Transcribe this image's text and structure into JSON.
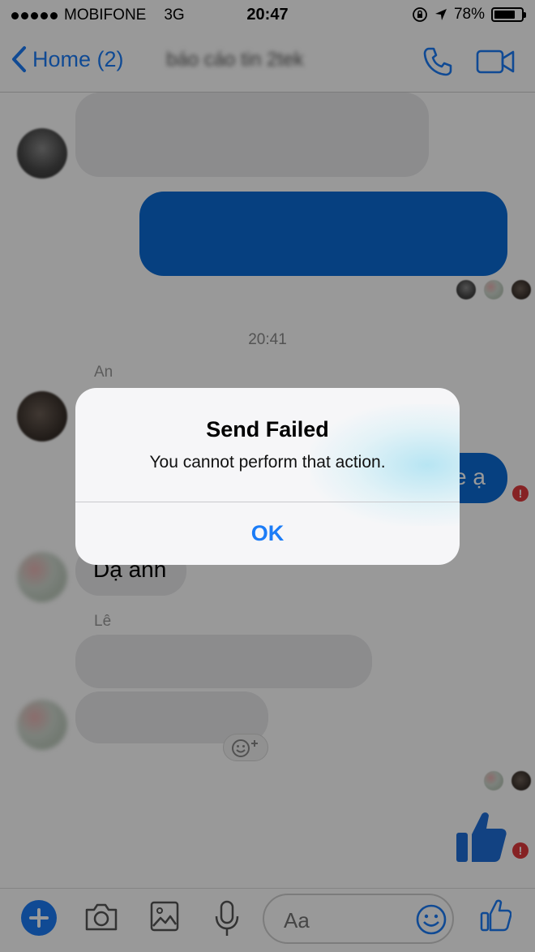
{
  "status_bar": {
    "carrier": "MOBIFONE",
    "network": "3G",
    "time": "20:47",
    "battery": "78%",
    "battery_level": 0.78
  },
  "nav": {
    "back_label": "Home (2)",
    "conversation_title": "báo cáo tin 2tek",
    "accent_color": "#1b7cf7"
  },
  "messages": {
    "timestamp": "20:41",
    "sender_an": "An",
    "sender_le": "Lê",
    "outgoing_partial_text": "e ạ",
    "incoming_text": "Dạ anh"
  },
  "composer": {
    "placeholder": "Aa"
  },
  "alert": {
    "title": "Send Failed",
    "message": "You cannot perform that action.",
    "ok_label": "OK"
  },
  "icons": [
    "chevron-left-icon",
    "phone-icon",
    "video-icon",
    "location-arrow-icon",
    "lock-rotation-icon",
    "plus-icon",
    "camera-icon",
    "image-icon",
    "microphone-icon",
    "emoji-icon",
    "thumbs-up-icon",
    "error-icon"
  ]
}
